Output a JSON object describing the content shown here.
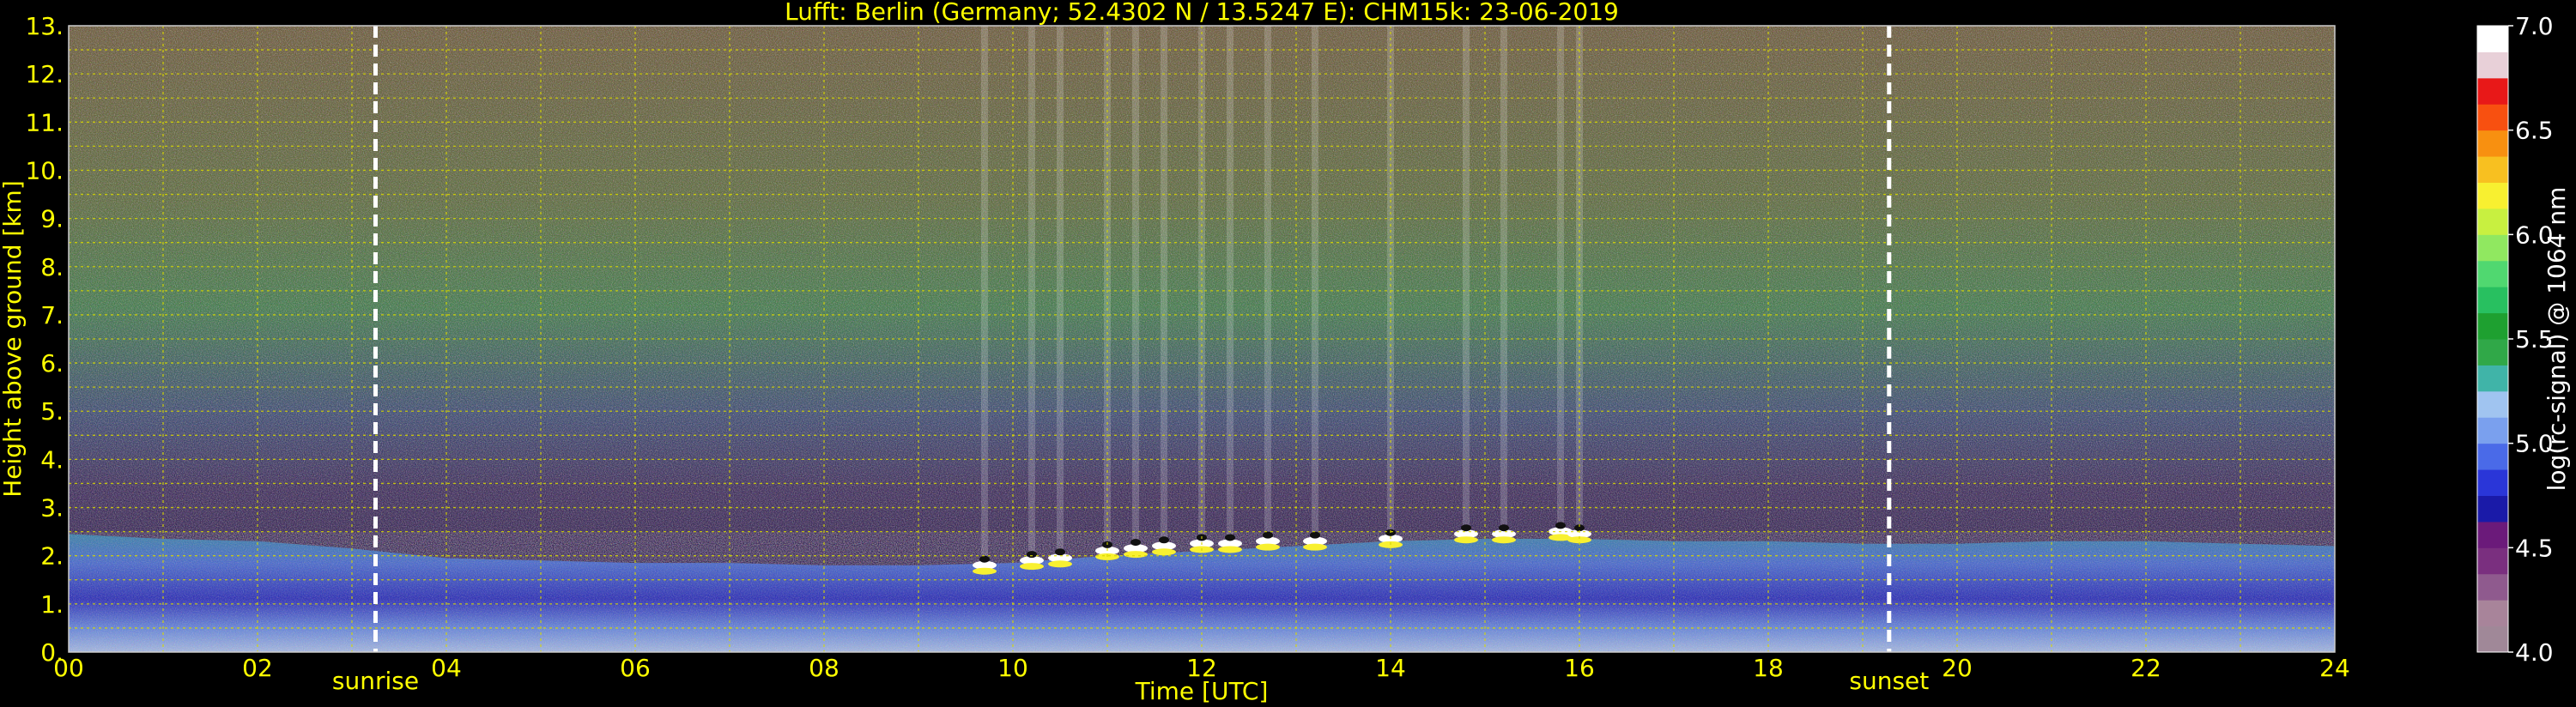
{
  "chart_data": {
    "type": "heatmap",
    "title": "Lufft: Berlin (Germany; 52.4302 N / 13.5247 E):    CHM15k: 23-06-2019",
    "xlabel": "Time [UTC]",
    "ylabel": "Height above ground [km]",
    "xlim": [
      0,
      24
    ],
    "ylim": [
      0,
      13
    ],
    "x_ticks": [
      "00",
      "02",
      "04",
      "06",
      "08",
      "10",
      "12",
      "14",
      "16",
      "18",
      "20",
      "22",
      "24"
    ],
    "y_ticks": [
      "0.",
      "1.",
      "2.",
      "3.",
      "4.",
      "5.",
      "6.",
      "7.",
      "8.",
      "9.",
      "10.",
      "11.",
      "12.",
      "13."
    ],
    "grid": true,
    "events": [
      {
        "label": "sunrise",
        "time": 3.25
      },
      {
        "label": "sunset",
        "time": 19.28
      }
    ],
    "colorbar": {
      "label": "log(rc-signal) @ 1064 nm",
      "range": [
        4.0,
        7.0
      ],
      "ticks": [
        "4.0",
        "4.5",
        "5.0",
        "5.5",
        "6.0",
        "6.5",
        "7.0"
      ],
      "colors": [
        "#a08898",
        "#a8849a",
        "#8f5a8e",
        "#7a2f7f",
        "#6b1a7a",
        "#1a1aa8",
        "#2a36d8",
        "#4a6ae8",
        "#7aa0ee",
        "#a0c4f0",
        "#40b4a8",
        "#30a848",
        "#1ea030",
        "#28c060",
        "#50d870",
        "#90e860",
        "#c8f040",
        "#f8f030",
        "#f8c020",
        "#f89010",
        "#f85010",
        "#e81818",
        "#e8d0d8",
        "#ffffff"
      ]
    },
    "layers": {
      "boundary_layer_top_km": [
        [
          0,
          2.45
        ],
        [
          1,
          2.35
        ],
        [
          2,
          2.3
        ],
        [
          3,
          2.15
        ],
        [
          4,
          1.95
        ],
        [
          5,
          1.9
        ],
        [
          6,
          1.85
        ],
        [
          7,
          1.85
        ],
        [
          8,
          1.8
        ],
        [
          9,
          1.8
        ],
        [
          10,
          1.85
        ],
        [
          11,
          2.0
        ],
        [
          12,
          2.1
        ],
        [
          13,
          2.2
        ],
        [
          14,
          2.3
        ],
        [
          15,
          2.35
        ],
        [
          16,
          2.35
        ],
        [
          17,
          2.3
        ],
        [
          18,
          2.3
        ],
        [
          19,
          2.25
        ],
        [
          20,
          2.25
        ],
        [
          21,
          2.3
        ],
        [
          22,
          2.3
        ],
        [
          23,
          2.25
        ],
        [
          24,
          2.2
        ]
      ],
      "clouds": [
        {
          "time": 9.7,
          "base_km": 1.75
        },
        {
          "time": 10.2,
          "base_km": 1.85
        },
        {
          "time": 10.5,
          "base_km": 1.9
        },
        {
          "time": 11.0,
          "base_km": 2.05
        },
        {
          "time": 11.3,
          "base_km": 2.1
        },
        {
          "time": 11.6,
          "base_km": 2.15
        },
        {
          "time": 12.0,
          "base_km": 2.2
        },
        {
          "time": 12.3,
          "base_km": 2.2
        },
        {
          "time": 12.7,
          "base_km": 2.25
        },
        {
          "time": 13.2,
          "base_km": 2.25
        },
        {
          "time": 14.0,
          "base_km": 2.3
        },
        {
          "time": 14.8,
          "base_km": 2.4
        },
        {
          "time": 15.2,
          "base_km": 2.4
        },
        {
          "time": 15.8,
          "base_km": 2.45
        },
        {
          "time": 16.0,
          "base_km": 2.4
        }
      ]
    }
  }
}
